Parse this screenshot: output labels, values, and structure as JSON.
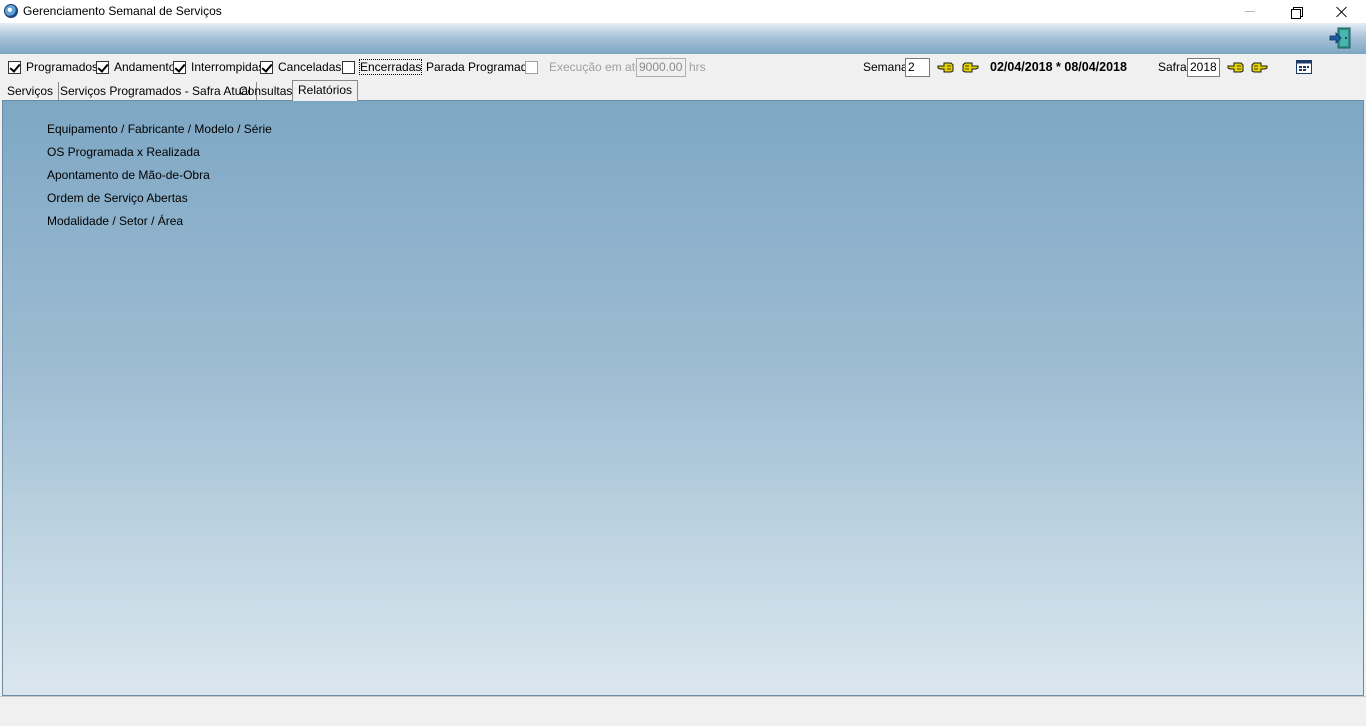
{
  "window": {
    "title": "Gerenciamento Semanal de Serviços"
  },
  "filters": {
    "programados": {
      "label": "Programados",
      "checked": true
    },
    "andamento": {
      "label": "Andamento",
      "checked": true
    },
    "interrompidas": {
      "label": "Interrompidas",
      "checked": true
    },
    "canceladas": {
      "label": "Canceladas",
      "checked": true
    },
    "encerradas": {
      "label": "Encerradas",
      "checked": false
    },
    "parada_programada": {
      "label": "Parada Programada",
      "checked": false
    },
    "execucao": {
      "label": "Execução em até",
      "value": "9000.00",
      "unit": "hrs"
    }
  },
  "week": {
    "label": "Semana",
    "value": "2",
    "range": "02/04/2018 * 08/04/2018"
  },
  "safra": {
    "label": "Safra",
    "value": "2018"
  },
  "tabs": [
    {
      "label": "Serviços",
      "active": false
    },
    {
      "label": "Serviços Programados - Safra Atual",
      "active": false
    },
    {
      "label": "Consultas",
      "active": false
    },
    {
      "label": "Relatórios",
      "active": true
    }
  ],
  "reports": [
    "Equipamento / Fabricante / Modelo / Série",
    "OS Programada x Realizada",
    "Apontamento de Mão-de-Obra",
    "Ordem de Serviço Abertas",
    "Modalidade / Setor / Área"
  ],
  "icons": {
    "app": "app-globe-icon",
    "exit": "exit-door-icon",
    "prev": "hand-pointing-left-icon",
    "next": "hand-pointing-right-icon",
    "calendar": "calendar-icon"
  },
  "colors": {
    "header_gradient_top": "#e6eef5",
    "header_gradient_bottom": "#7ea7c4",
    "panel_gradient_top": "#7ea7c4",
    "panel_gradient_bottom": "#dbe7ee",
    "window_bg": "#f0f0f0"
  }
}
